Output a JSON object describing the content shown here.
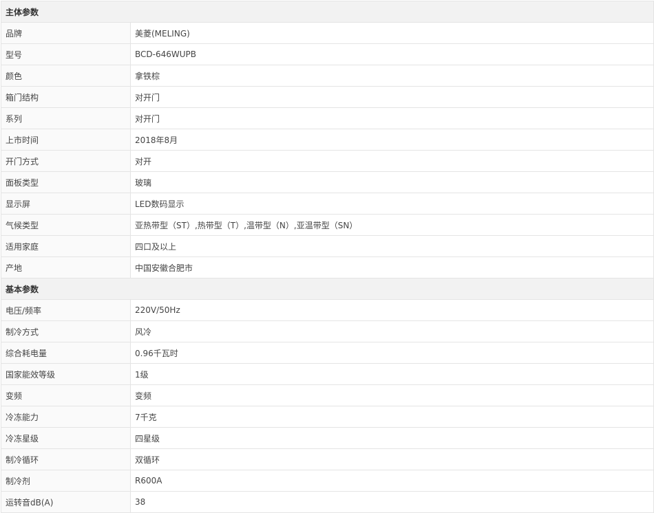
{
  "sections": [
    {
      "title": "主体参数",
      "rows": [
        {
          "label": "品牌",
          "value": "美菱(MELING)"
        },
        {
          "label": "型号",
          "value": "BCD-646WUPB"
        },
        {
          "label": "颜色",
          "value": "拿铁棕"
        },
        {
          "label": "箱门结构",
          "value": "对开门"
        },
        {
          "label": "系列",
          "value": "对开门"
        },
        {
          "label": "上市时间",
          "value": "2018年8月"
        },
        {
          "label": "开门方式",
          "value": "对开"
        },
        {
          "label": "面板类型",
          "value": "玻璃"
        },
        {
          "label": "显示屏",
          "value": "LED数码显示"
        },
        {
          "label": "气候类型",
          "value": "亚热带型（ST）,热带型（T）,温带型（N）,亚温带型（SN）"
        },
        {
          "label": "适用家庭",
          "value": "四口及以上"
        },
        {
          "label": "产地",
          "value": "中国安徽合肥市"
        }
      ]
    },
    {
      "title": "基本参数",
      "rows": [
        {
          "label": "电压/频率",
          "value": "220V/50Hz"
        },
        {
          "label": "制冷方式",
          "value": "风冷"
        },
        {
          "label": "综合耗电量",
          "value": "0.96千瓦时"
        },
        {
          "label": "国家能效等级",
          "value": "1级"
        },
        {
          "label": "变频",
          "value": "变频"
        },
        {
          "label": "冷冻能力",
          "value": "7千克"
        },
        {
          "label": "冷冻星级",
          "value": "四星级"
        },
        {
          "label": "制冷循环",
          "value": "双循环"
        },
        {
          "label": "制冷剂",
          "value": "R600A"
        },
        {
          "label": "运转音dB(A)",
          "value": "38"
        }
      ]
    }
  ]
}
